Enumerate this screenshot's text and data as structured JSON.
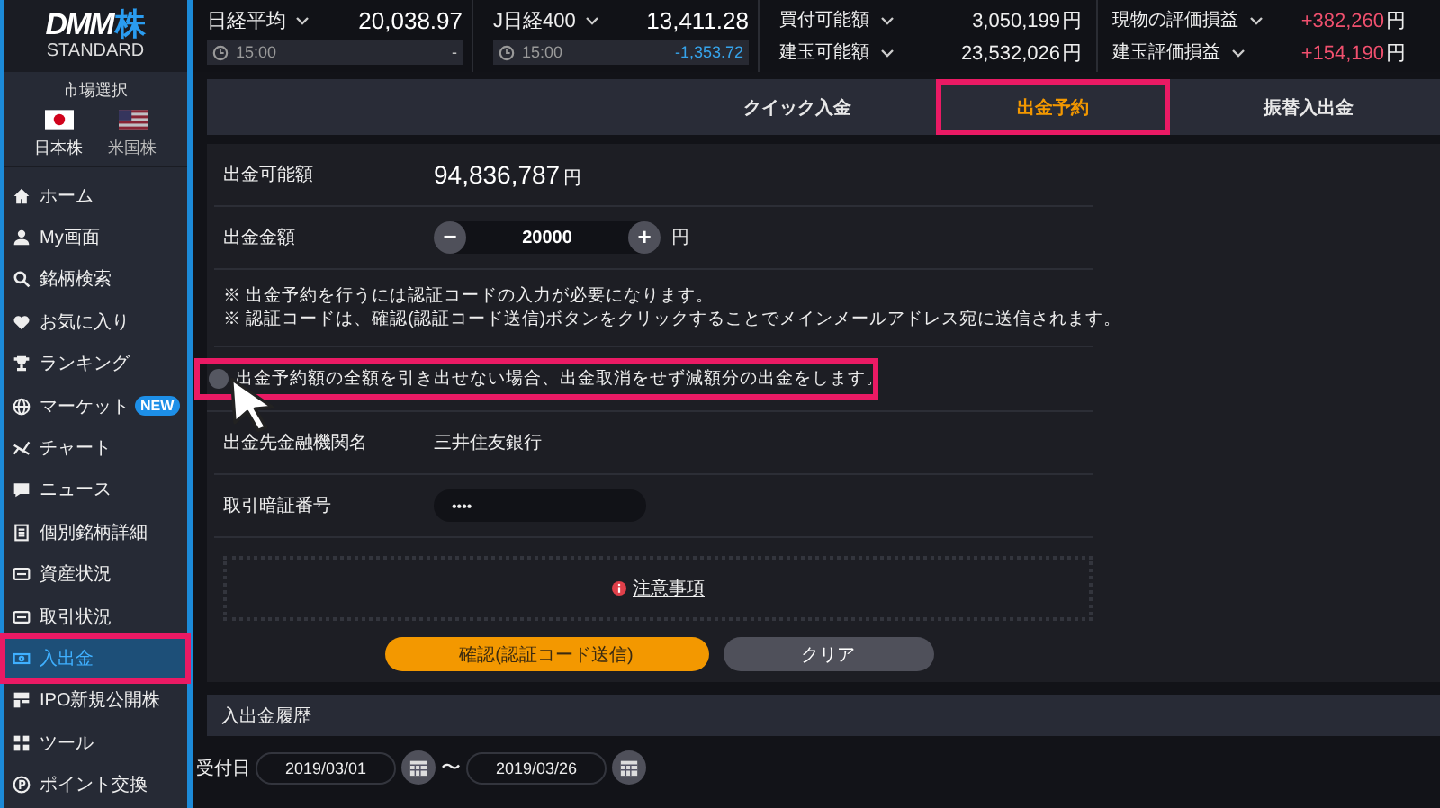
{
  "logo": {
    "brand": "DMM",
    "suffix": "株",
    "sub": "STANDARD"
  },
  "market": {
    "label": "市場選択",
    "options": [
      {
        "kind": "jp",
        "label": "日本株",
        "selected": true
      },
      {
        "kind": "us",
        "label": "米国株",
        "selected": false
      }
    ]
  },
  "nav": [
    {
      "label": "ホーム",
      "selected": false,
      "annotated": false
    },
    {
      "label": "My画面",
      "selected": false,
      "annotated": false
    },
    {
      "label": "銘柄検索",
      "selected": false,
      "annotated": false
    },
    {
      "label": "お気に入り",
      "selected": false,
      "annotated": false
    },
    {
      "label": "ランキング",
      "selected": false,
      "annotated": false
    },
    {
      "label": "マーケット",
      "badge": "NEW",
      "selected": false,
      "annotated": false
    },
    {
      "label": "チャート",
      "selected": false,
      "annotated": false
    },
    {
      "label": "ニュース",
      "selected": false,
      "annotated": false
    },
    {
      "label": "個別銘柄詳細",
      "selected": false,
      "annotated": false
    },
    {
      "label": "資産状況",
      "selected": false,
      "annotated": false
    },
    {
      "label": "取引状況",
      "selected": false,
      "annotated": false
    },
    {
      "label": "入出金",
      "selected": true,
      "annotated": true
    },
    {
      "label": "IPO新規公開株",
      "selected": false,
      "annotated": false
    },
    {
      "label": "ツール",
      "selected": false,
      "annotated": false
    },
    {
      "label": "ポイント交換",
      "selected": false,
      "annotated": false
    }
  ],
  "indices": [
    {
      "name": "日経平均",
      "value": "20,038.97",
      "time": "15:00",
      "change": "-",
      "color": "#cccccc"
    },
    {
      "name": "J日経400",
      "value": "13,411.28",
      "time": "15:00",
      "change": "-1,353.72",
      "color": "#36a3ea"
    }
  ],
  "account": [
    [
      {
        "label": "買付可能額",
        "value": "3,050,199",
        "unit": "円",
        "color": "#eeeeee"
      },
      {
        "label": "建玉可能額",
        "value": "23,532,026",
        "unit": "円",
        "color": "#eeeeee"
      }
    ],
    [
      {
        "label": "現物の評価損益",
        "value": "+382,260",
        "unit": "円",
        "color": "#f0506e"
      },
      {
        "label": "建玉評価損益",
        "value": "+154,190",
        "unit": "円",
        "color": "#f0506e"
      }
    ]
  ],
  "tabs": [
    {
      "label": "クイック入金",
      "selected": false,
      "annotated": false
    },
    {
      "label": "出金予約",
      "selected": true,
      "annotated": true
    },
    {
      "label": "振替入出金",
      "selected": false,
      "annotated": false
    }
  ],
  "form": {
    "available": {
      "label": "出金可能額",
      "value": "94,836,787",
      "unit": "円"
    },
    "amount": {
      "label": "出金金額",
      "minus": "−",
      "value": "20000",
      "plus": "+",
      "unit": "円"
    },
    "notes": [
      "※ 出金予約を行うには認証コードの入力が必要になります。",
      "※ 認証コードは、確認(認証コード送信)ボタンをクリックすることでメインメールアドレス宛に送信されます。"
    ],
    "option": {
      "label": "出金予約額の全額を引き出せない場合、出金取消をせず減額分の出金をします。",
      "checked": false,
      "annotated": true
    },
    "bank": {
      "label": "出金先金融機関名",
      "value": "三井住友銀行"
    },
    "pin": {
      "label": "取引暗証番号",
      "value": "••••"
    },
    "notice": "注意事項",
    "buttons": [
      {
        "kind": "primary",
        "label": "確認(認証コード送信)"
      },
      {
        "kind": "secondary",
        "label": "クリア"
      }
    ]
  },
  "history": {
    "title": "入出金履歴",
    "filter_label": "受付日",
    "from": "2019/03/01",
    "separator": "〜",
    "to": "2019/03/26"
  }
}
